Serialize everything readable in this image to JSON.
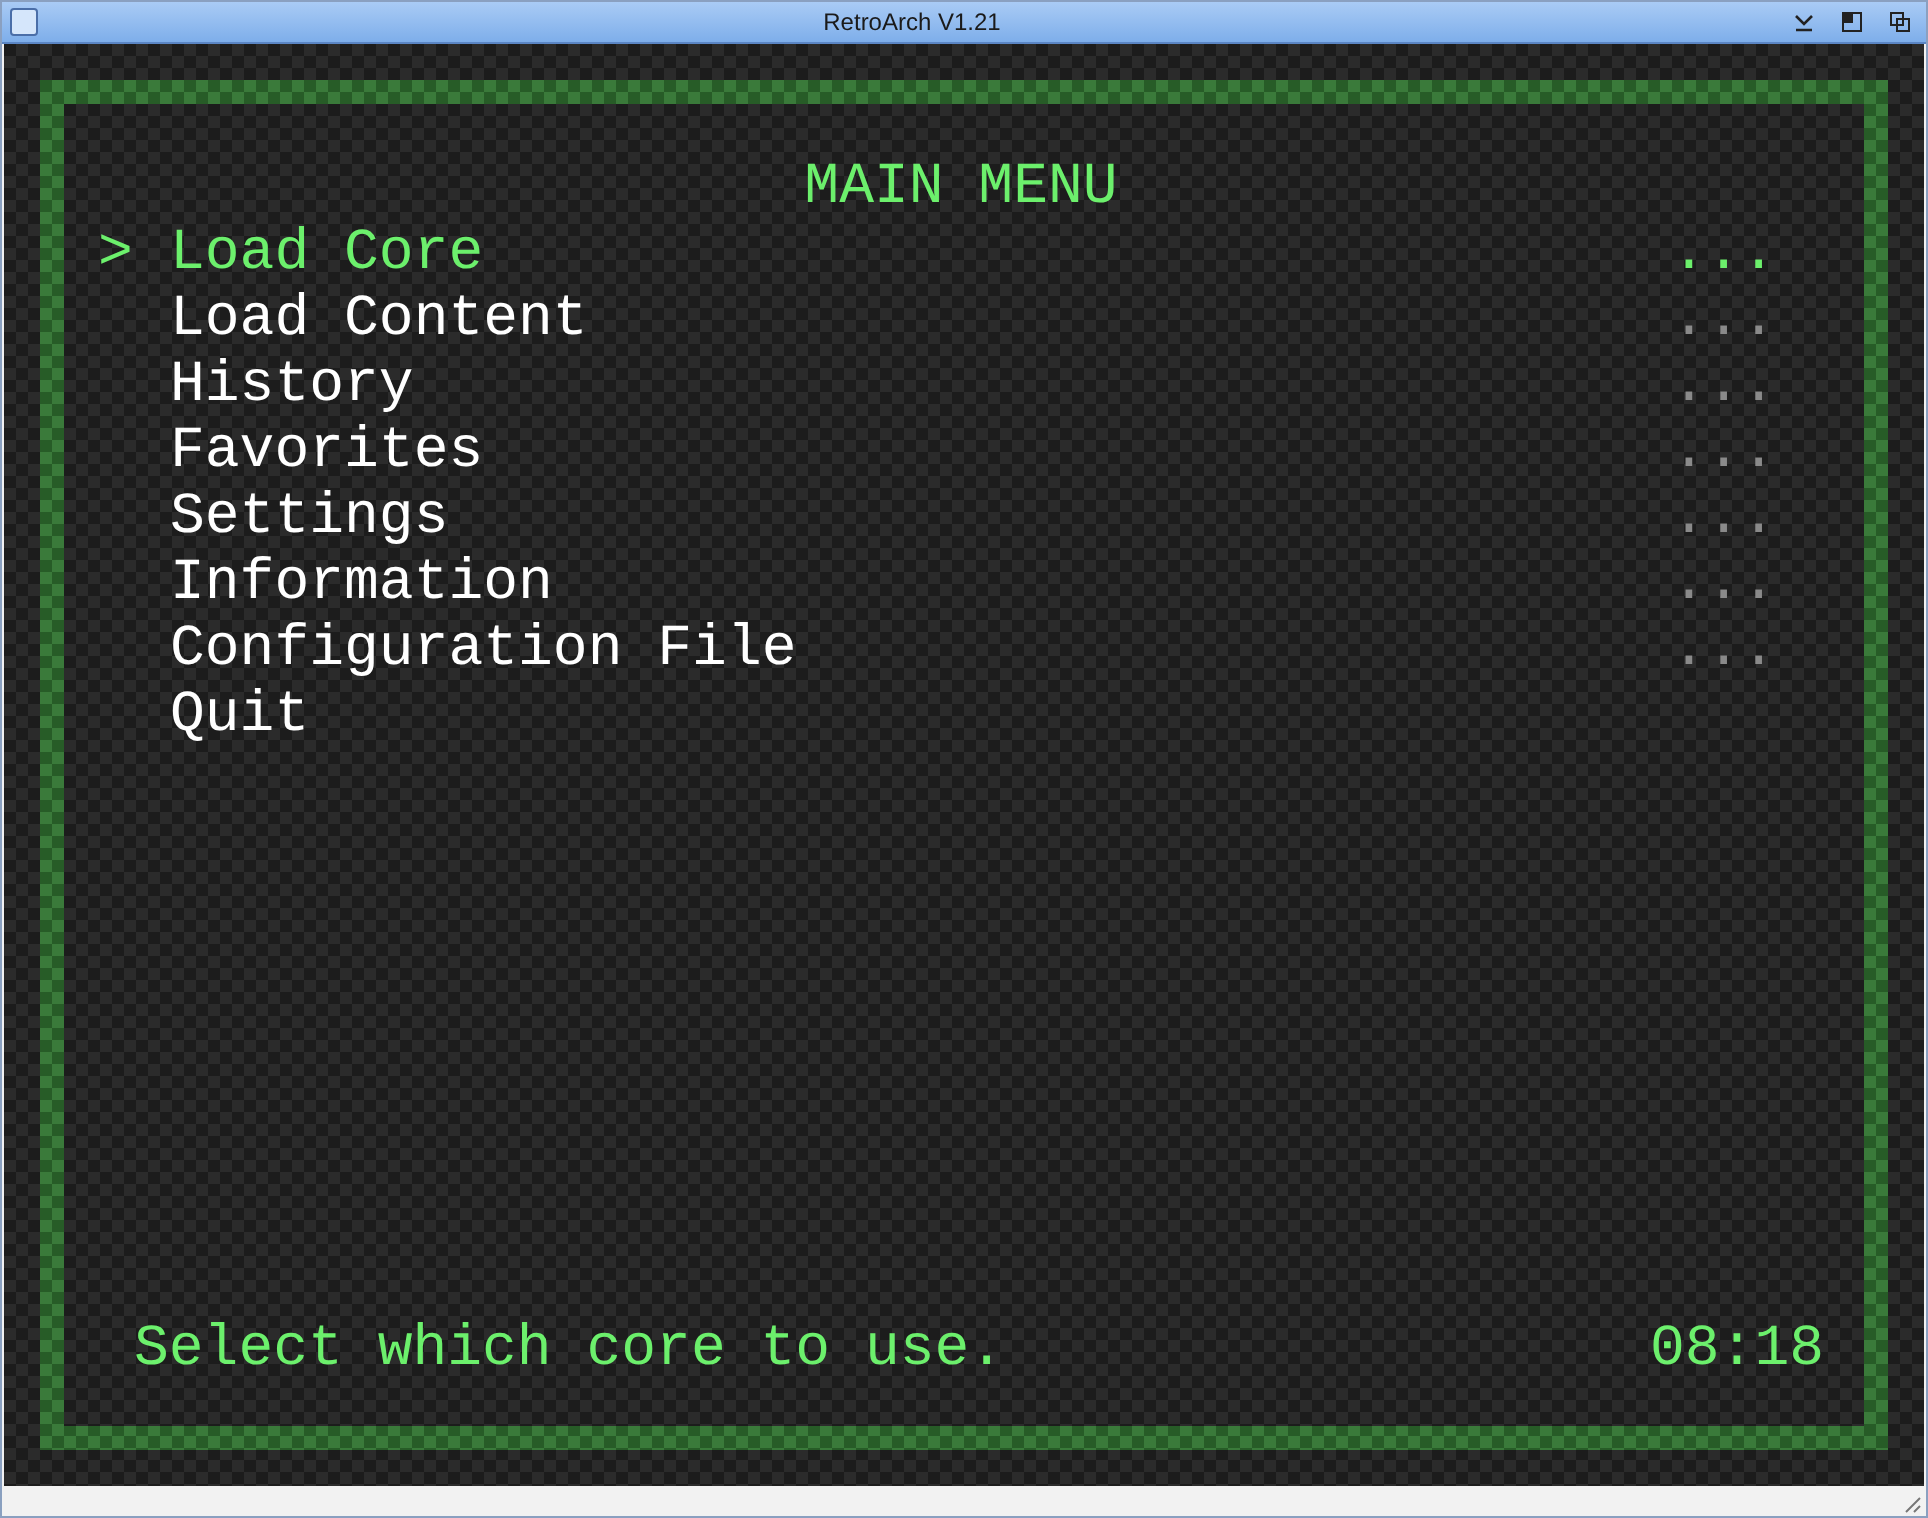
{
  "window": {
    "title": "RetroArch V1.21"
  },
  "menu": {
    "title": "MAIN MENU",
    "cursor": ">",
    "items": [
      {
        "label": "Load Core",
        "value": "...",
        "selected": true
      },
      {
        "label": "Load Content",
        "value": "...",
        "selected": false
      },
      {
        "label": "History",
        "value": "...",
        "selected": false
      },
      {
        "label": "Favorites",
        "value": "...",
        "selected": false
      },
      {
        "label": "Settings",
        "value": "...",
        "selected": false
      },
      {
        "label": "Information",
        "value": "...",
        "selected": false
      },
      {
        "label": "Configuration File",
        "value": "...",
        "selected": false
      },
      {
        "label": "Quit",
        "selected": false
      }
    ]
  },
  "footer": {
    "hint": "Select which core to use.",
    "clock": "08:18"
  }
}
